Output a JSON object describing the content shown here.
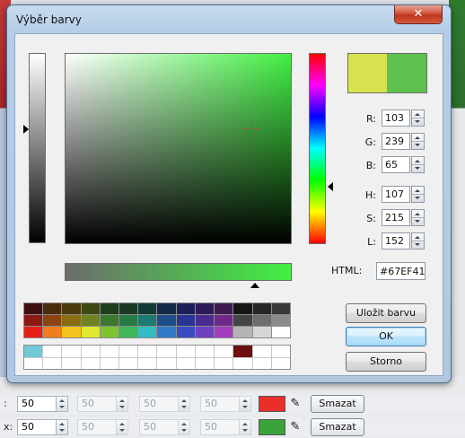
{
  "background": {
    "rows": [
      {
        "label": ":",
        "values": [
          "50",
          "50",
          "50",
          "50"
        ],
        "swatch": "#ea2e2a",
        "button": "Smazat"
      },
      {
        "label": "x:",
        "values": [
          "50",
          "50",
          "50",
          "50"
        ],
        "swatch": "#3aa43a",
        "button": "Smazat"
      }
    ]
  },
  "dialog": {
    "title": "Výběr barvy",
    "close_glyph": "✕",
    "preview": {
      "new_color": "#d8e250",
      "old_color": "#5ec24f"
    },
    "fields": {
      "r_label": "R:",
      "r_value": "103",
      "g_label": "G:",
      "g_value": "239",
      "b_label": "B:",
      "b_value": "65",
      "h_label": "H:",
      "h_value": "107",
      "s_label": "S:",
      "s_value": "215",
      "l_label": "L:",
      "l_value": "152"
    },
    "html_label": "HTML:",
    "html_value": "#67EF41",
    "palette": [
      "#3f0e0e",
      "#4a2b0e",
      "#4b3c0e",
      "#3e4a14",
      "#1f3e1b",
      "#1b3a26",
      "#123b38",
      "#142a47",
      "#1c1f5a",
      "#2c1b58",
      "#3e1c52",
      "#161616",
      "#262626",
      "#383838",
      "#8c1a12",
      "#8a4512",
      "#8a6d12",
      "#6d8420",
      "#3b7a2e",
      "#287a45",
      "#1b7a73",
      "#1e4e8a",
      "#2a3496",
      "#4b2a92",
      "#70298a",
      "#444444",
      "#6d6d6d",
      "#8c8c8c",
      "#e81f17",
      "#f07d1f",
      "#f4c21c",
      "#e0e92f",
      "#7dc42f",
      "#3fb55c",
      "#34bcc4",
      "#3079c8",
      "#3a4cc3",
      "#6e41bf",
      "#a43dbd",
      "#b4b4b4",
      "#d6d6d6",
      "#ffffff"
    ],
    "custom_colors": [
      "#72c8d4",
      "#ffffff",
      "#ffffff",
      "#ffffff",
      "#ffffff",
      "#ffffff",
      "#ffffff",
      "#ffffff",
      "#ffffff",
      "#ffffff",
      "#ffffff",
      "#6e0f12",
      "#ffffff",
      "#ffffff",
      "#ffffff",
      "#ffffff",
      "#ffffff",
      "#ffffff",
      "#ffffff",
      "#ffffff",
      "#ffffff",
      "#ffffff",
      "#ffffff",
      "#ffffff",
      "#ffffff",
      "#ffffff",
      "#ffffff",
      "#ffffff"
    ],
    "buttons": {
      "save": "Uložit barvu",
      "ok": "OK",
      "cancel": "Storno"
    }
  }
}
